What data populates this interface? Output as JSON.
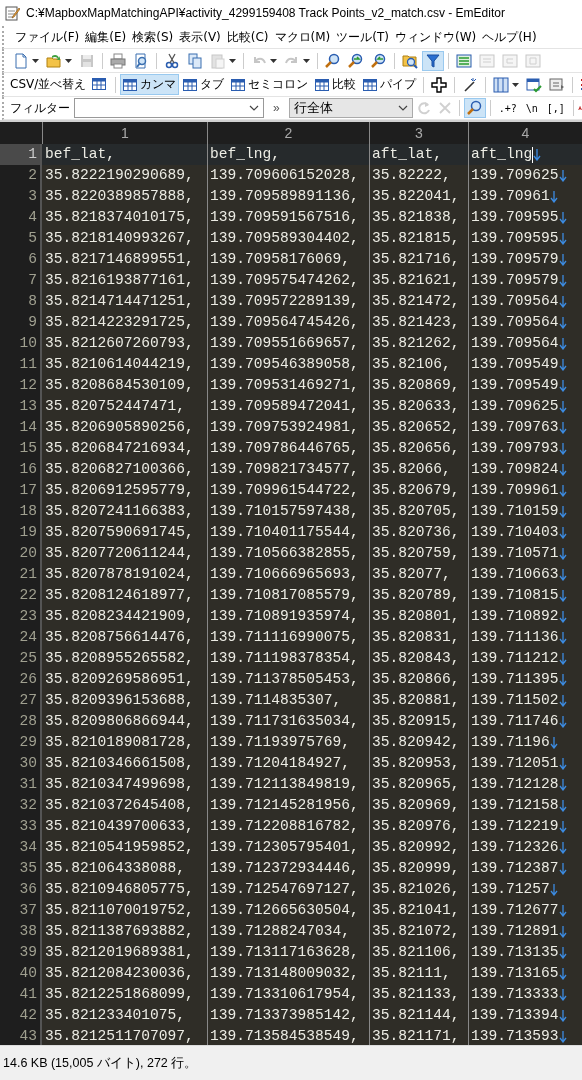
{
  "window": {
    "title": "C:¥MapboxMapMatchingAPI¥activity_4299159408 Track Points_v2_match.csv - EmEditor"
  },
  "menu": [
    "ファイル(F)",
    "編集(E)",
    "検索(S)",
    "表示(V)",
    "比較(C)",
    "マクロ(M)",
    "ツール(T)",
    "ウィンドウ(W)",
    "ヘルプ(H)"
  ],
  "toolbar": [
    {
      "kind": "split",
      "disabled": false,
      "selected": false
    },
    {
      "kind": "split",
      "disabled": false,
      "selected": false
    },
    {
      "kind": "button",
      "disabled": true,
      "selected": false
    },
    {
      "kind": "separator"
    },
    {
      "kind": "button",
      "disabled": false,
      "selected": false
    },
    {
      "kind": "button",
      "disabled": false,
      "selected": false
    },
    {
      "kind": "separator"
    },
    {
      "kind": "button",
      "disabled": false,
      "selected": false
    },
    {
      "kind": "button",
      "disabled": false,
      "selected": false
    },
    {
      "kind": "split",
      "disabled": true,
      "selected": false
    },
    {
      "kind": "separator"
    },
    {
      "kind": "split",
      "disabled": true,
      "selected": false
    },
    {
      "kind": "split",
      "disabled": true,
      "selected": false
    },
    {
      "kind": "separator"
    },
    {
      "kind": "button",
      "disabled": false,
      "selected": false
    },
    {
      "kind": "button",
      "disabled": false,
      "selected": false
    },
    {
      "kind": "button",
      "disabled": false,
      "selected": false
    },
    {
      "kind": "separator"
    },
    {
      "kind": "button",
      "disabled": false,
      "selected": false
    },
    {
      "kind": "button",
      "disabled": false,
      "selected": true
    },
    {
      "kind": "separator"
    },
    {
      "kind": "button",
      "disabled": false,
      "selected": false
    },
    {
      "kind": "button",
      "disabled": true,
      "selected": false
    },
    {
      "kind": "button",
      "disabled": true,
      "selected": false
    },
    {
      "kind": "button",
      "disabled": true,
      "selected": false
    }
  ],
  "csv_toolbar": [
    {
      "kind": "label",
      "label": "CSV/並べ替え"
    },
    {
      "kind": "icon"
    },
    {
      "kind": "separator"
    },
    {
      "kind": "mode",
      "label": "カンマ",
      "selected": true
    },
    {
      "kind": "mode",
      "label": "タブ",
      "selected": false
    },
    {
      "kind": "mode",
      "label": "セミコロン",
      "selected": false
    },
    {
      "kind": "mode",
      "label": "比較",
      "selected": false
    },
    {
      "kind": "mode",
      "label": "パイプ",
      "selected": false
    },
    {
      "kind": "separator"
    },
    {
      "kind": "icon"
    },
    {
      "kind": "separator"
    },
    {
      "kind": "icon"
    },
    {
      "kind": "separator"
    },
    {
      "kind": "icon"
    },
    {
      "kind": "icon"
    },
    {
      "kind": "icon"
    },
    {
      "kind": "separator"
    },
    {
      "kind": "icon"
    }
  ],
  "filter_bar": {
    "label": "フィルター",
    "more": "»",
    "scope": "行全体",
    "search_selected": true,
    "options": [
      ".+?",
      "\\n",
      "[,]"
    ]
  },
  "editor": {
    "columns": [
      "1",
      "2",
      "3",
      "4"
    ],
    "rows": [
      {
        "line": "1",
        "current": true,
        "cells": [
          "bef_lat,",
          "bef_lng,",
          "aft_lat,",
          "aft_lng"
        ]
      },
      {
        "line": "2",
        "current": false,
        "cells": [
          "35.8222190290689,",
          "139.709606152028,",
          "35.82222,",
          "139.709625"
        ]
      },
      {
        "line": "3",
        "current": false,
        "cells": [
          "35.8220389857888,",
          "139.709589891136,",
          "35.822041,",
          "139.70961"
        ]
      },
      {
        "line": "4",
        "current": false,
        "cells": [
          "35.8218374010175,",
          "139.709591567516,",
          "35.821838,",
          "139.709595"
        ]
      },
      {
        "line": "5",
        "current": false,
        "cells": [
          "35.8218140993267,",
          "139.709589304402,",
          "35.821815,",
          "139.709595"
        ]
      },
      {
        "line": "6",
        "current": false,
        "cells": [
          "35.8217146899551,",
          "139.70958176069,",
          "35.821716,",
          "139.709579"
        ]
      },
      {
        "line": "7",
        "current": false,
        "cells": [
          "35.8216193877161,",
          "139.709575474262,",
          "35.821621,",
          "139.709579"
        ]
      },
      {
        "line": "8",
        "current": false,
        "cells": [
          "35.8214714471251,",
          "139.709572289139,",
          "35.821472,",
          "139.709564"
        ]
      },
      {
        "line": "9",
        "current": false,
        "cells": [
          "35.8214223291725,",
          "139.709564745426,",
          "35.821423,",
          "139.709564"
        ]
      },
      {
        "line": "10",
        "current": false,
        "cells": [
          "35.8212607260793,",
          "139.709551669657,",
          "35.821262,",
          "139.709564"
        ]
      },
      {
        "line": "11",
        "current": false,
        "cells": [
          "35.8210614044219,",
          "139.709546389058,",
          "35.82106,",
          "139.709549"
        ]
      },
      {
        "line": "12",
        "current": false,
        "cells": [
          "35.8208684530109,",
          "139.709531469271,",
          "35.820869,",
          "139.709549"
        ]
      },
      {
        "line": "13",
        "current": false,
        "cells": [
          "35.820752447471,",
          "139.709589472041,",
          "35.820633,",
          "139.709625"
        ]
      },
      {
        "line": "14",
        "current": false,
        "cells": [
          "35.8206905890256,",
          "139.709753924981,",
          "35.820652,",
          "139.709763"
        ]
      },
      {
        "line": "15",
        "current": false,
        "cells": [
          "35.8206847216934,",
          "139.709786446765,",
          "35.820656,",
          "139.709793"
        ]
      },
      {
        "line": "16",
        "current": false,
        "cells": [
          "35.8206827100366,",
          "139.709821734577,",
          "35.82066,",
          "139.709824"
        ]
      },
      {
        "line": "17",
        "current": false,
        "cells": [
          "35.8206912595779,",
          "139.709961544722,",
          "35.820679,",
          "139.709961"
        ]
      },
      {
        "line": "18",
        "current": false,
        "cells": [
          "35.8207241166383,",
          "139.710157597438,",
          "35.820705,",
          "139.710159"
        ]
      },
      {
        "line": "19",
        "current": false,
        "cells": [
          "35.8207590691745,",
          "139.710401175544,",
          "35.820736,",
          "139.710403"
        ]
      },
      {
        "line": "20",
        "current": false,
        "cells": [
          "35.8207720611244,",
          "139.710566382855,",
          "35.820759,",
          "139.710571"
        ]
      },
      {
        "line": "21",
        "current": false,
        "cells": [
          "35.8207878191024,",
          "139.710666965693,",
          "35.82077,",
          "139.710663"
        ]
      },
      {
        "line": "22",
        "current": false,
        "cells": [
          "35.8208124618977,",
          "139.710817085579,",
          "35.820789,",
          "139.710815"
        ]
      },
      {
        "line": "23",
        "current": false,
        "cells": [
          "35.8208234421909,",
          "139.710891935974,",
          "35.820801,",
          "139.710892"
        ]
      },
      {
        "line": "24",
        "current": false,
        "cells": [
          "35.8208756614476,",
          "139.711116990075,",
          "35.820831,",
          "139.711136"
        ]
      },
      {
        "line": "25",
        "current": false,
        "cells": [
          "35.8208955265582,",
          "139.711198378354,",
          "35.820843,",
          "139.711212"
        ]
      },
      {
        "line": "26",
        "current": false,
        "cells": [
          "35.8209269586951,",
          "139.711378505453,",
          "35.820866,",
          "139.711395"
        ]
      },
      {
        "line": "27",
        "current": false,
        "cells": [
          "35.8209396153688,",
          "139.7114835307,",
          "35.820881,",
          "139.711502"
        ]
      },
      {
        "line": "28",
        "current": false,
        "cells": [
          "35.8209806866944,",
          "139.711731635034,",
          "35.820915,",
          "139.711746"
        ]
      },
      {
        "line": "29",
        "current": false,
        "cells": [
          "35.8210189081728,",
          "139.71193975769,",
          "35.820942,",
          "139.71196"
        ]
      },
      {
        "line": "30",
        "current": false,
        "cells": [
          "35.8210346661508,",
          "139.71204184927,",
          "35.820953,",
          "139.712051"
        ]
      },
      {
        "line": "31",
        "current": false,
        "cells": [
          "35.8210347499698,",
          "139.712113849819,",
          "35.820965,",
          "139.712128"
        ]
      },
      {
        "line": "32",
        "current": false,
        "cells": [
          "35.8210372645408,",
          "139.712145281956,",
          "35.820969,",
          "139.712158"
        ]
      },
      {
        "line": "33",
        "current": false,
        "cells": [
          "35.8210439700633,",
          "139.712208816782,",
          "35.820976,",
          "139.712219"
        ]
      },
      {
        "line": "34",
        "current": false,
        "cells": [
          "35.8210541959852,",
          "139.712305795401,",
          "35.820992,",
          "139.712326"
        ]
      },
      {
        "line": "35",
        "current": false,
        "cells": [
          "35.821064338088,",
          "139.712372934446,",
          "35.820999,",
          "139.712387"
        ]
      },
      {
        "line": "36",
        "current": false,
        "cells": [
          "35.8210946805775,",
          "139.712547697127,",
          "35.821026,",
          "139.71257"
        ]
      },
      {
        "line": "37",
        "current": false,
        "cells": [
          "35.8211070019752,",
          "139.712665630504,",
          "35.821041,",
          "139.712677"
        ]
      },
      {
        "line": "38",
        "current": false,
        "cells": [
          "35.8211387693882,",
          "139.71288247034,",
          "35.821072,",
          "139.712891"
        ]
      },
      {
        "line": "39",
        "current": false,
        "cells": [
          "35.8212019689381,",
          "139.713117163628,",
          "35.821106,",
          "139.713135"
        ]
      },
      {
        "line": "40",
        "current": false,
        "cells": [
          "35.8212084230036,",
          "139.713148009032,",
          "35.82111,",
          "139.713165"
        ]
      },
      {
        "line": "41",
        "current": false,
        "cells": [
          "35.8212251868099,",
          "139.713310617954,",
          "35.821133,",
          "139.713333"
        ]
      },
      {
        "line": "42",
        "current": false,
        "cells": [
          "35.821233401075,",
          "139.713373985142,",
          "35.821144,",
          "139.713394"
        ]
      },
      {
        "line": "43",
        "current": false,
        "cells": [
          "35.8212511707097,",
          "139.713584538549,",
          "35.821171,",
          "139.713593"
        ]
      }
    ]
  },
  "status_bar": "14.6 KB (15,005 バイト), 272 行。"
}
